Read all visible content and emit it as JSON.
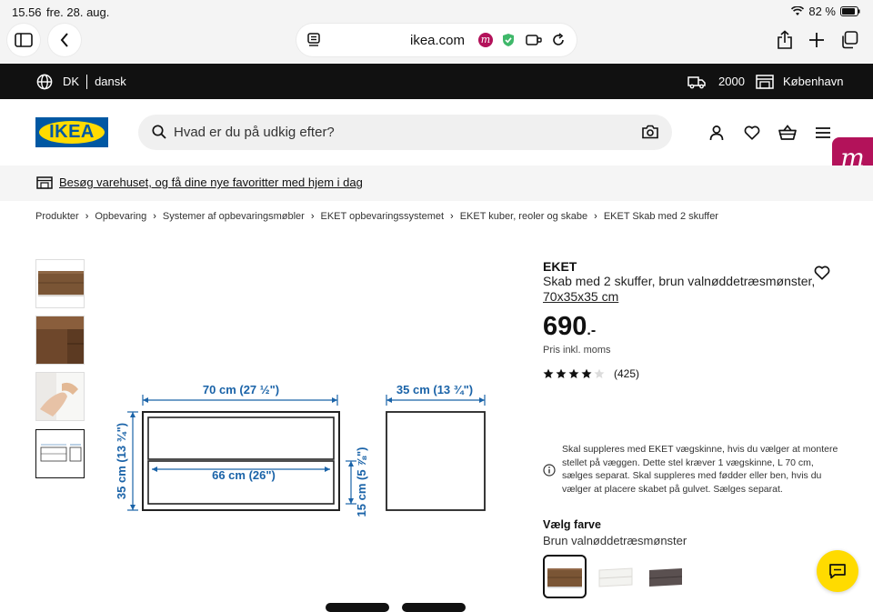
{
  "statusbar": {
    "time": "15.56",
    "date": "fre. 28. aug.",
    "battery": "82 %"
  },
  "browser": {
    "url": "ikea.com"
  },
  "topbar": {
    "country": "DK",
    "language": "dansk",
    "zip": "2000",
    "store": "København"
  },
  "header": {
    "logo": "IKEA",
    "search_placeholder": "Hvad er du på udkig efter?",
    "badge_letter": "m"
  },
  "promo": {
    "text": "Besøg varehuset, og få dine nye favoritter med hjem i dag"
  },
  "breadcrumb": [
    "Produkter",
    "Opbevaring",
    "Systemer af opbevaringsmøbler",
    "EKET opbevaringssystemet",
    "EKET kuber, reoler og skabe",
    "EKET Skab med 2 skuffer"
  ],
  "dimensions": {
    "width": "70 cm (27 ½\")",
    "depth": "35 cm (13 ¾\")",
    "height": "35 cm (13 ¾\")",
    "inner_width": "66 cm (26\")",
    "drawer_height": "15 cm (5 ⅞\")"
  },
  "product": {
    "brand": "EKET",
    "name": "Skab med 2 skuffer, brun valnøddetræsmønster,",
    "size": "70x35x35 cm",
    "price": "690",
    "price_suffix": ".-",
    "vat_note": "Pris inkl. moms",
    "rating": 4,
    "rating_max": 5,
    "review_count": "(425)",
    "note": "Skal suppleres med EKET vægskinne, hvis du vælger at montere stellet på væggen. Dette stel kræver 1 vægskinne, L 70 cm, sælges separat. Skal suppleres med fødder eller ben, hvis du vælger at placere skabet på gulvet. Sælges separat.",
    "color_label": "Vælg farve",
    "color_value": "Brun valnøddetræsmønster"
  },
  "colors": {
    "walnut": "#7a5535",
    "white": "#f3f3f0",
    "darkgrey": "#5a5050",
    "ikea_blue": "#0058a3",
    "ikea_yellow": "#ffdb00",
    "dimension_blue": "#1a63a8"
  }
}
